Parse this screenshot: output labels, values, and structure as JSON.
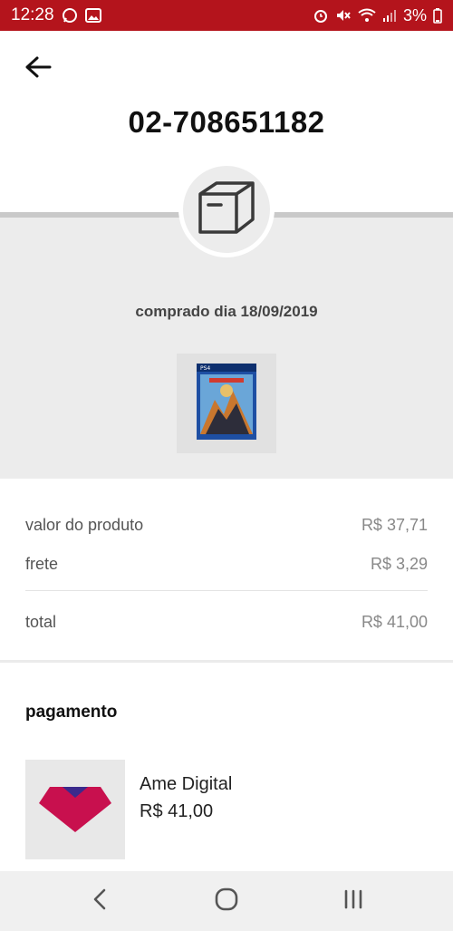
{
  "status_bar": {
    "time": "12:28",
    "battery": "3%",
    "color": "#b4141c",
    "left_icons": [
      "whatsapp-icon",
      "gallery-icon"
    ],
    "right_icons": [
      "alarm-icon",
      "mute-icon",
      "wifi-icon",
      "signal-icon",
      "battery-icon"
    ]
  },
  "header": {
    "back_icon": "arrow-left-icon",
    "order_number": "02-708651182",
    "box_icon": "package-box-icon"
  },
  "order": {
    "purchase_date": "comprado dia 18/09/2019",
    "product_image": "game-cover-thumbnail"
  },
  "prices": {
    "product_label": "valor do produto",
    "product_value": "R$ 37,71",
    "shipping_label": "frete",
    "shipping_value": "R$ 3,29",
    "total_label": "total",
    "total_value": "R$ 41,00"
  },
  "payment": {
    "title": "pagamento",
    "method_name": "Ame Digital",
    "method_amount": "R$ 41,00",
    "logo_icon": "ame-digital-logo",
    "logo_color": "#c8104e"
  },
  "nav_bar": {
    "icons": [
      "back-nav-icon",
      "home-nav-icon",
      "recents-nav-icon"
    ]
  }
}
